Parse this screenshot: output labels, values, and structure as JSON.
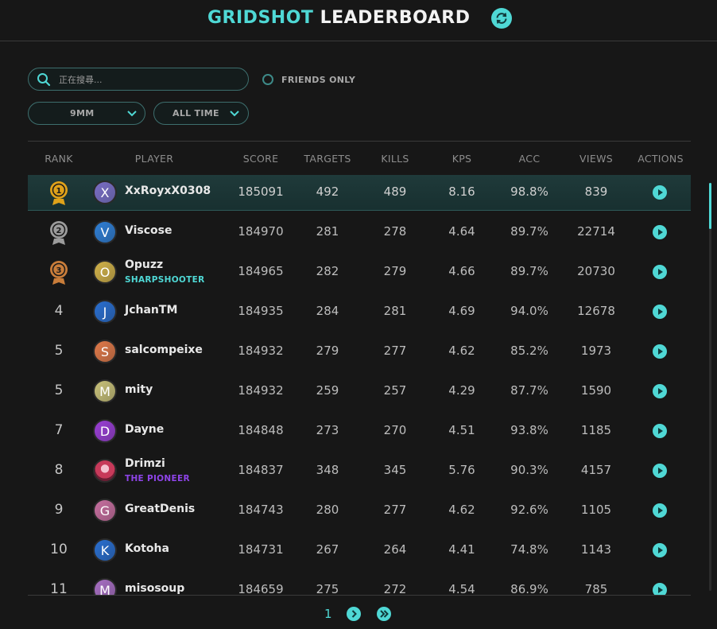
{
  "header": {
    "title_accent": "GRIDSHOT",
    "title_rest": "LEADERBOARD"
  },
  "filters": {
    "search_placeholder": "正在搜尋...",
    "search_value": "",
    "friends_only_label": "FRIENDS ONLY",
    "weapon_selected": "9MM",
    "time_selected": "ALL TIME"
  },
  "columns": [
    "RANK",
    "PLAYER",
    "SCORE",
    "TARGETS",
    "KILLS",
    "KPS",
    "ACC",
    "VIEWS",
    "ACTIONS"
  ],
  "colors": {
    "accent": "#4fd8d5",
    "gold": "#e0a21a",
    "silver": "#9c9c9c",
    "bronze": "#c97d3a",
    "title_sharpshooter": "#4fd8d5",
    "title_pioneer": "#8e44e8"
  },
  "rows": [
    {
      "rank": "1",
      "medal": "gold",
      "initial": "X",
      "avatar_color": "#7a6cc4",
      "player": "XxRoyxX0308",
      "title": "",
      "score": "185091",
      "targets": "492",
      "kills": "489",
      "kps": "8.16",
      "acc": "98.8%",
      "views": "839"
    },
    {
      "rank": "2",
      "medal": "silver",
      "initial": "V",
      "avatar_color": "#2f7fd6",
      "player": "Viscose",
      "title": "",
      "score": "184970",
      "targets": "281",
      "kills": "278",
      "kps": "4.64",
      "acc": "89.7%",
      "views": "22714"
    },
    {
      "rank": "3",
      "medal": "bronze",
      "initial": "O",
      "avatar_color": "#d1b24a",
      "player": "Opuzz",
      "title": "SHARPSHOOTER",
      "title_color": "#4fd8d5",
      "score": "184965",
      "targets": "282",
      "kills": "279",
      "kps": "4.66",
      "acc": "89.7%",
      "views": "20730"
    },
    {
      "rank": "4",
      "medal": "",
      "initial": "J",
      "avatar_color": "#2a6fd0",
      "player": "JchanTM",
      "title": "",
      "score": "184935",
      "targets": "284",
      "kills": "281",
      "kps": "4.69",
      "acc": "94.0%",
      "views": "12678"
    },
    {
      "rank": "5",
      "medal": "",
      "initial": "S",
      "avatar_color": "#e07a4a",
      "player": "salcompeixe",
      "title": "",
      "score": "184932",
      "targets": "279",
      "kills": "277",
      "kps": "4.62",
      "acc": "85.2%",
      "views": "1973"
    },
    {
      "rank": "5",
      "medal": "",
      "initial": "M",
      "avatar_color": "#c9c27a",
      "player": "mity",
      "title": "",
      "score": "184932",
      "targets": "259",
      "kills": "257",
      "kps": "4.29",
      "acc": "87.7%",
      "views": "1590"
    },
    {
      "rank": "7",
      "medal": "",
      "initial": "D",
      "avatar_color": "#9a3fd6",
      "player": "Dayne",
      "title": "",
      "score": "184848",
      "targets": "273",
      "kills": "270",
      "kps": "4.51",
      "acc": "93.8%",
      "views": "1185"
    },
    {
      "rank": "8",
      "medal": "",
      "initial": "",
      "avatar_color": "#c73a5a",
      "avatar_image": true,
      "player": "Drimzi",
      "title": "THE PIONEER",
      "title_color": "#8e44e8",
      "score": "184837",
      "targets": "348",
      "kills": "345",
      "kps": "5.76",
      "acc": "90.3%",
      "views": "4157"
    },
    {
      "rank": "9",
      "medal": "",
      "initial": "G",
      "avatar_color": "#c76fa0",
      "player": "GreatDenis",
      "title": "",
      "score": "184743",
      "targets": "280",
      "kills": "277",
      "kps": "4.62",
      "acc": "92.6%",
      "views": "1105"
    },
    {
      "rank": "10",
      "medal": "",
      "initial": "K",
      "avatar_color": "#2a6fd0",
      "player": "Kotoha",
      "title": "",
      "score": "184731",
      "targets": "267",
      "kills": "264",
      "kps": "4.41",
      "acc": "74.8%",
      "views": "1143"
    },
    {
      "rank": "11",
      "medal": "",
      "initial": "M",
      "avatar_color": "#a86fc4",
      "player": "misosoup",
      "title": "",
      "score": "184659",
      "targets": "275",
      "kills": "272",
      "kps": "4.54",
      "acc": "86.9%",
      "views": "785"
    }
  ],
  "pagination": {
    "current_page": "1"
  }
}
